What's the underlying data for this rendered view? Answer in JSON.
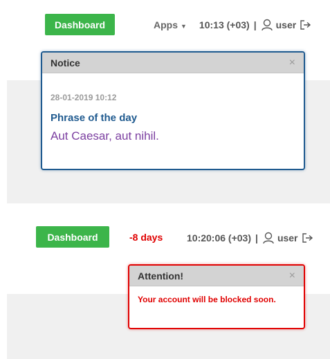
{
  "panel1": {
    "dashboard_label": "Dashboard",
    "apps_label": "Apps",
    "time": "10:13 (+03)",
    "separator": "|",
    "user_label": "user",
    "dialog": {
      "title": "Notice",
      "close": "×",
      "date": "28-01-2019 10:12",
      "heading": "Phrase of the day",
      "phrase": "Aut Caesar, aut nihil."
    }
  },
  "panel2": {
    "dashboard_label": "Dashboard",
    "days_label": "-8 days",
    "time": "10:20:06 (+03)",
    "separator": "|",
    "user_label": "user",
    "dialog": {
      "title": "Attention!",
      "close": "×",
      "message": "Your account will be blocked soon."
    }
  },
  "colors": {
    "dashboard_green": "#3cb54a",
    "notice_border": "#1f5a8f",
    "notice_phrase": "#7b3ea0",
    "attention_red": "#e00000",
    "header_gray": "#d3d3d3"
  },
  "icons": [
    "user-icon",
    "logout-icon",
    "caret-down-icon",
    "close-icon"
  ]
}
